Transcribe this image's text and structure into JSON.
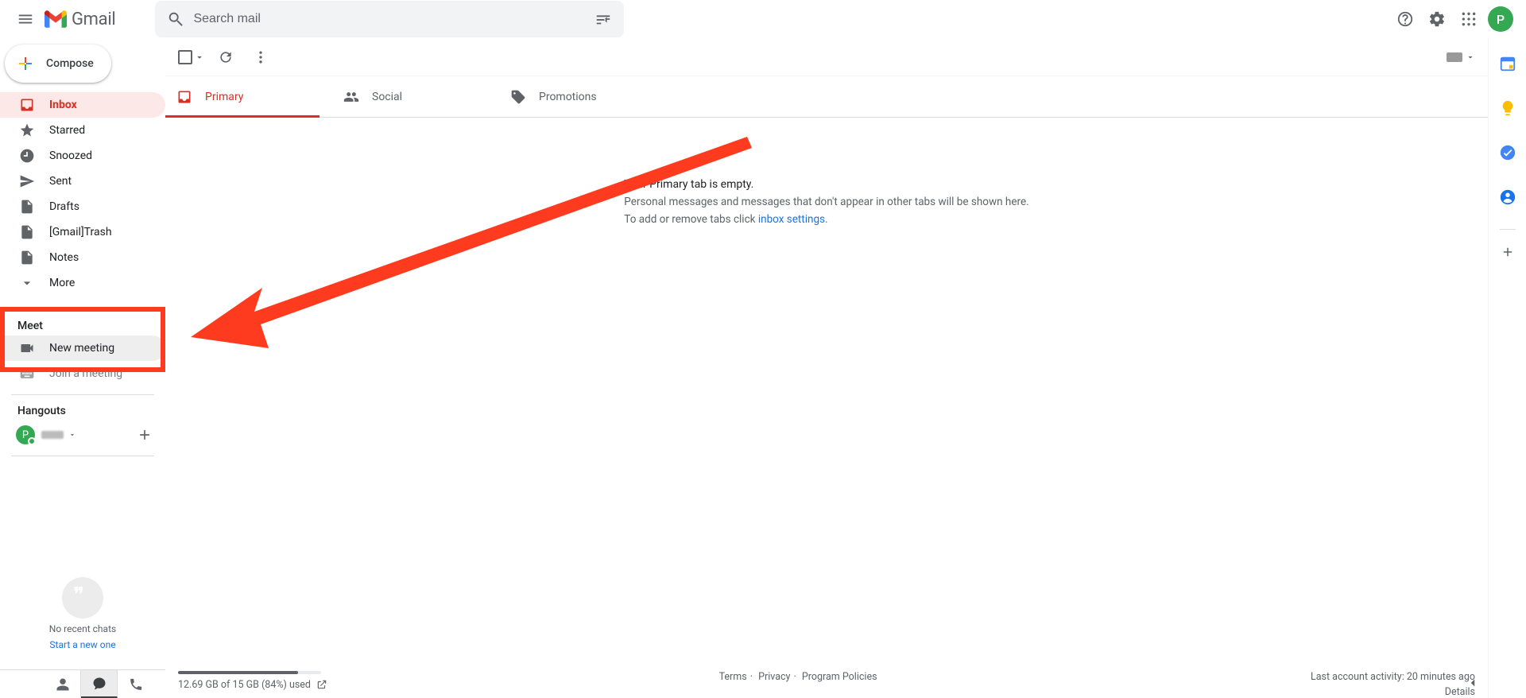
{
  "app_name": "Gmail",
  "search": {
    "placeholder": "Search mail"
  },
  "avatar_initial": "P",
  "compose_label": "Compose",
  "nav": [
    {
      "key": "inbox",
      "label": "Inbox",
      "icon": "inbox"
    },
    {
      "key": "starred",
      "label": "Starred",
      "icon": "star"
    },
    {
      "key": "snoozed",
      "label": "Snoozed",
      "icon": "clock"
    },
    {
      "key": "sent",
      "label": "Sent",
      "icon": "send"
    },
    {
      "key": "drafts",
      "label": "Drafts",
      "icon": "file"
    },
    {
      "key": "gtrash",
      "label": "[Gmail]Trash",
      "icon": "file"
    },
    {
      "key": "notes",
      "label": "Notes",
      "icon": "file"
    },
    {
      "key": "more",
      "label": "More",
      "icon": "chevron-down"
    }
  ],
  "meet": {
    "heading": "Meet",
    "new_meeting": "New meeting",
    "join_meeting": "Join a meeting"
  },
  "hangouts": {
    "heading": "Hangouts",
    "no_recent": "No recent chats",
    "start_new": "Start a new one"
  },
  "tabs": {
    "primary": "Primary",
    "social": "Social",
    "promotions": "Promotions"
  },
  "empty": {
    "title": "Your Primary tab is empty.",
    "line2": "Personal messages and messages that don't appear in other tabs will be shown here.",
    "line3_pre": "To add or remove tabs click ",
    "line3_link": "inbox settings",
    "line3_post": "."
  },
  "footer": {
    "storage_text": "12.69 GB of 15 GB (84%) used",
    "storage_pct": 84,
    "terms": "Terms",
    "privacy": "Privacy",
    "policies": "Program Policies",
    "activity": "Last account activity: 20 minutes ago",
    "details": "Details"
  }
}
